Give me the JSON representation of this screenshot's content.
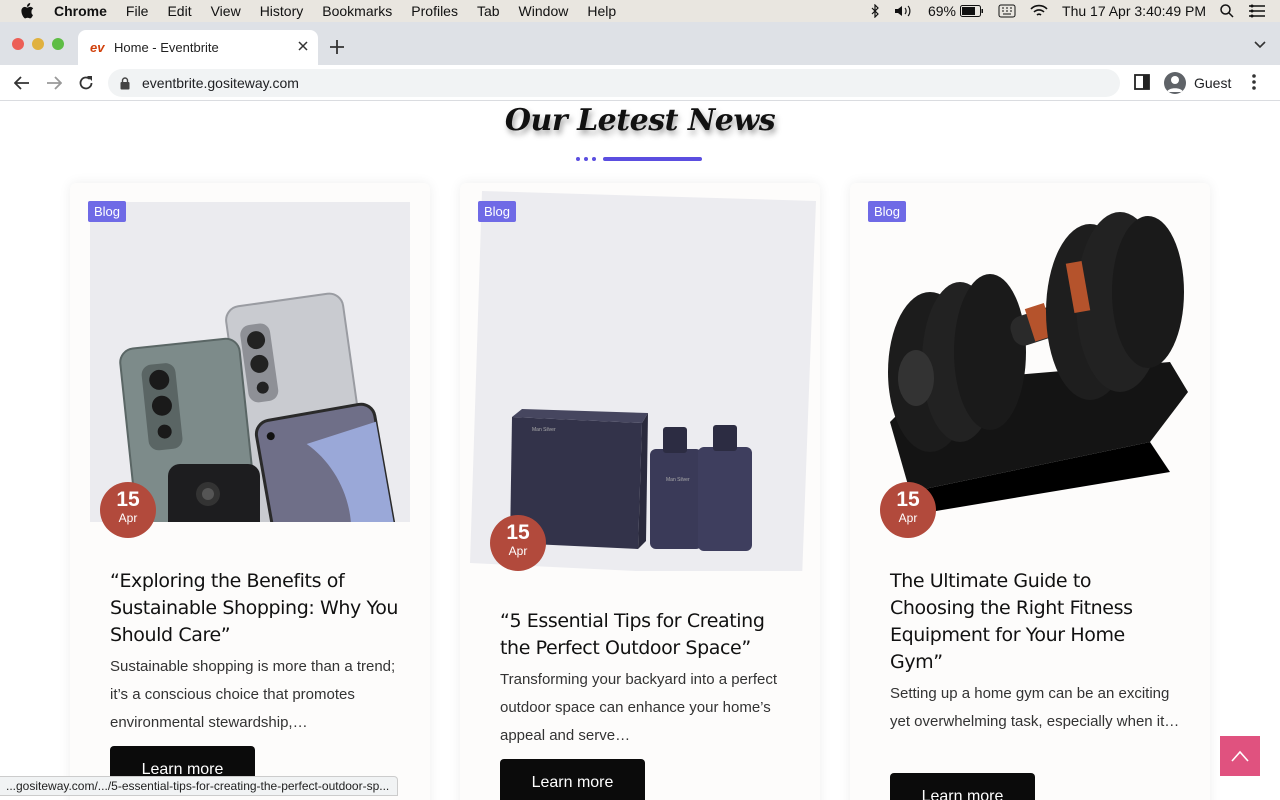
{
  "menubar": {
    "app": "Chrome",
    "items": [
      "File",
      "Edit",
      "View",
      "History",
      "Bookmarks",
      "Profiles",
      "Tab",
      "Window",
      "Help"
    ],
    "battery": "69%",
    "datetime": "Thu 17 Apr  3:40:49 PM"
  },
  "tab": {
    "favicon": "ev",
    "title": "Home - Eventbrite"
  },
  "address": {
    "url": "eventbrite.gositeway.com"
  },
  "profile": {
    "label": "Guest"
  },
  "page": {
    "heading": "Our Letest News",
    "accent": "#5b4ee0",
    "cards": [
      {
        "badge": "Blog",
        "day": "15",
        "month": "Apr",
        "title": "“Exploring the Benefits of Sustainable Shopping: Why You Should Care”",
        "excerpt": "Sustainable shopping is more than a trend; it’s a conscious choice that promotes environmental stewardship,…",
        "button": "Learn more"
      },
      {
        "badge": "Blog",
        "day": "15",
        "month": "Apr",
        "title": "“5 Essential Tips for Creating the Perfect Outdoor Space”",
        "excerpt": "Transforming your backyard into a perfect outdoor space can enhance your home’s appeal and serve…",
        "button": "Learn more",
        "product_text_1": "Man Silver",
        "product_text_2": "Man Silver"
      },
      {
        "badge": "Blog",
        "day": "15",
        "month": "Apr",
        "title": "The Ultimate Guide to Choosing the Right Fitness Equipment for Your Home Gym”",
        "excerpt": "Setting up a home gym can be an exciting yet overwhelming task, especially when it…",
        "button": "Learn more"
      }
    ]
  },
  "status_url": "...gositeway.com/.../5-essential-tips-for-creating-the-perfect-outdoor-sp..."
}
